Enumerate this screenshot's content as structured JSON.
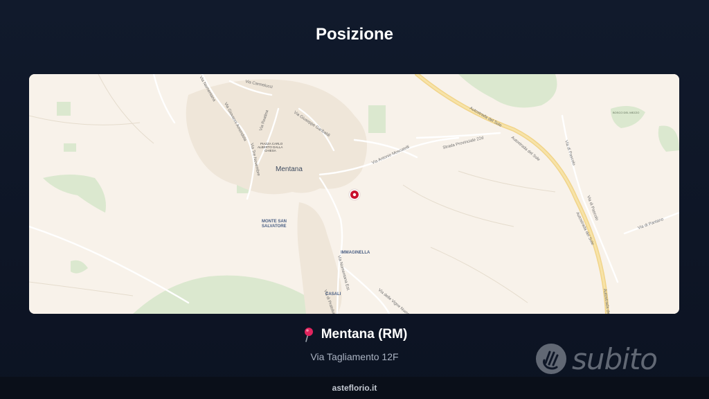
{
  "page": {
    "title": "Posizione"
  },
  "map": {
    "places": {
      "mentana": "Mentana",
      "monte_san_salvatore_1": "MONTE SAN",
      "monte_san_salvatore_2": "SALVATORE",
      "immaginella": "IMMAGINELLA",
      "casali": "CASALI",
      "piazza_1": "PIAZZA CARLO",
      "piazza_2": "ALBERTO DALLA",
      "piazza_3": "CHIESA",
      "bosco": "BOSCO DEL MEZZO"
    },
    "roads": {
      "carmelucci": "Via Carmelucci",
      "amendola": "Via Giovanni Amendola",
      "reatina": "Via Reatina",
      "tre_novembre": "Via Tre Novembre",
      "giuseppe_garibaldi": "Via Giuseppe Garibaldi",
      "antonio_moscatelli": "Via Antonio Moscatelli",
      "provinciale": "Strada Provinciale 22d",
      "autostrada_1": "Autostrada del Sole",
      "autostrada_2": "Autostrada del Sole",
      "autostrada_3": "Autostrada del Sole",
      "autostrada_4": "Autostrada del Sole",
      "via_pascolo_1": "Via di Pascolo",
      "via_pascolo_2": "Via di Pascolo",
      "via_pantano": "Via di Pantano",
      "nomentana": "Via Nomentana Est.",
      "vigne_nuove": "Via delle Vigne Nuove",
      "pratolungo": "Via di Pratolungo",
      "sinistra_top": "Via Nomentana"
    },
    "marker_icon": "map-marker-icon"
  },
  "location": {
    "pin_icon": "round-pushpin-icon",
    "city": "Mentana (RM)",
    "address": "Via Tagliamento 12F"
  },
  "watermark": {
    "text": "subito",
    "icon": "subito-hand-icon"
  },
  "footer": {
    "text": "asteflorio.it"
  },
  "colors": {
    "background": "#111a2c",
    "map_base": "#f8f2ea",
    "green_areas": "#dbe8cf",
    "motorway": "#f1d48a",
    "marker": "#c8102e"
  }
}
